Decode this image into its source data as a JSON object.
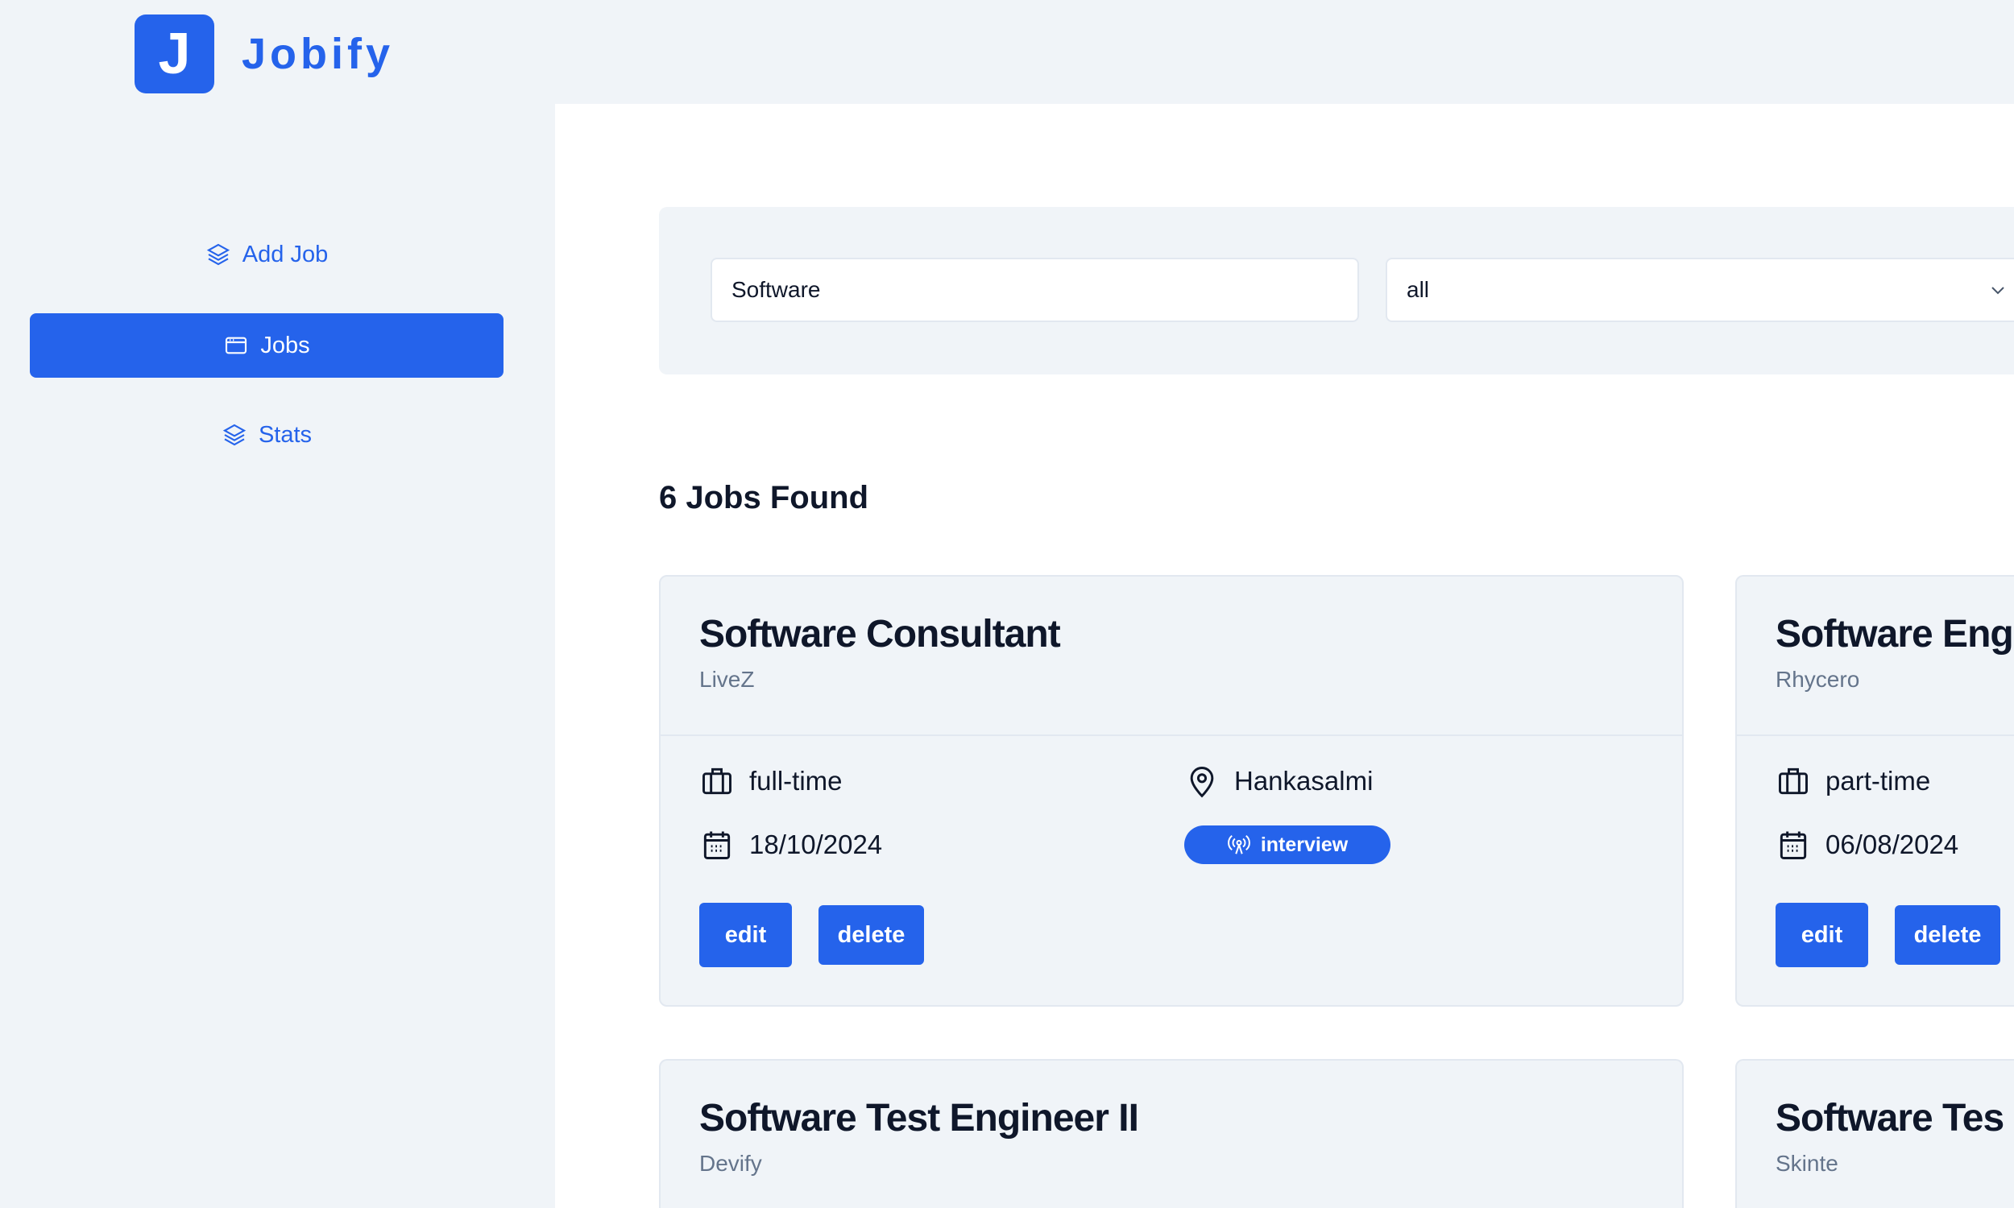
{
  "brand": {
    "logo_letter": "J",
    "name": "Jobify"
  },
  "sidebar": {
    "items": [
      {
        "label": "Add Job",
        "icon": "layers-icon"
      },
      {
        "label": "Jobs",
        "icon": "window-icon",
        "active": true
      },
      {
        "label": "Stats",
        "icon": "layers-icon"
      }
    ]
  },
  "filters": {
    "search_value": "Software",
    "status_value": "all"
  },
  "results": {
    "title": "6 Jobs Found"
  },
  "colors": {
    "accent": "#2563eb",
    "background": "#f0f4f8"
  },
  "jobs": [
    {
      "title": "Software Consultant",
      "company": "LiveZ",
      "type": "full-time",
      "location": "Hankasalmi",
      "date": "18/10/2024",
      "status": "interview",
      "edit": "edit",
      "delete": "delete"
    },
    {
      "title": "Software Eng",
      "company": "Rhycero",
      "type": "part-time",
      "date": "06/08/2024",
      "edit": "edit",
      "delete": "delete"
    },
    {
      "title": "Software Test Engineer II",
      "company": "Devify"
    },
    {
      "title": "Software Tes",
      "company": "Skinte"
    }
  ]
}
